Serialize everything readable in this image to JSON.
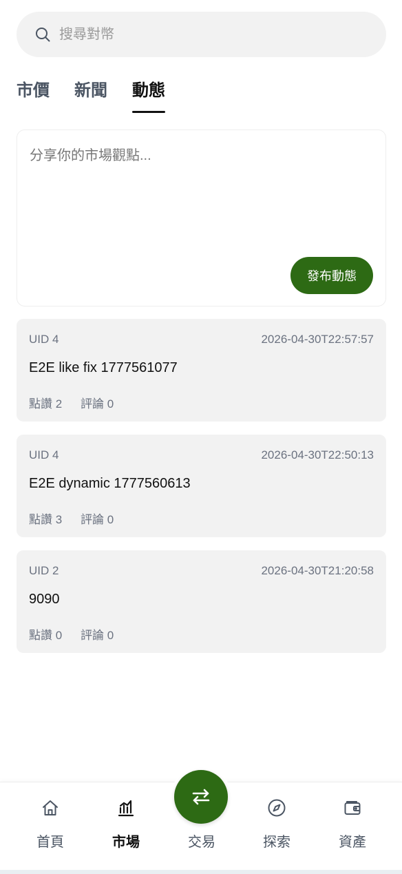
{
  "search": {
    "placeholder": "搜尋對幣"
  },
  "tabs": [
    {
      "label": "市價",
      "active": false
    },
    {
      "label": "新聞",
      "active": false
    },
    {
      "label": "動態",
      "active": true
    }
  ],
  "composer": {
    "placeholder": "分享你的市場觀點...",
    "publish_label": "發布動態"
  },
  "posts": [
    {
      "uid": "UID 4",
      "time": "2026-04-30T22:57:57",
      "content": "E2E like fix 1777561077",
      "likes": "點讚 2",
      "comments": "評論 0"
    },
    {
      "uid": "UID 4",
      "time": "2026-04-30T22:50:13",
      "content": "E2E dynamic 1777560613",
      "likes": "點讚 3",
      "comments": "評論 0"
    },
    {
      "uid": "UID 2",
      "time": "2026-04-30T21:20:58",
      "content": "9090",
      "likes": "點讚 0",
      "comments": "評論 0"
    }
  ],
  "nav": {
    "items": [
      {
        "label": "首頁",
        "icon": "home-icon",
        "active": false
      },
      {
        "label": "市場",
        "icon": "market-chart-icon",
        "active": true
      },
      {
        "label": "交易",
        "icon": "swap-arrows-icon",
        "active": false
      },
      {
        "label": "探索",
        "icon": "compass-icon",
        "active": false
      },
      {
        "label": "資產",
        "icon": "wallet-icon",
        "active": false
      }
    ]
  },
  "colors": {
    "accent": "#2d6a14",
    "card_bg": "#f2f2f2",
    "muted_text": "#6b7280"
  }
}
